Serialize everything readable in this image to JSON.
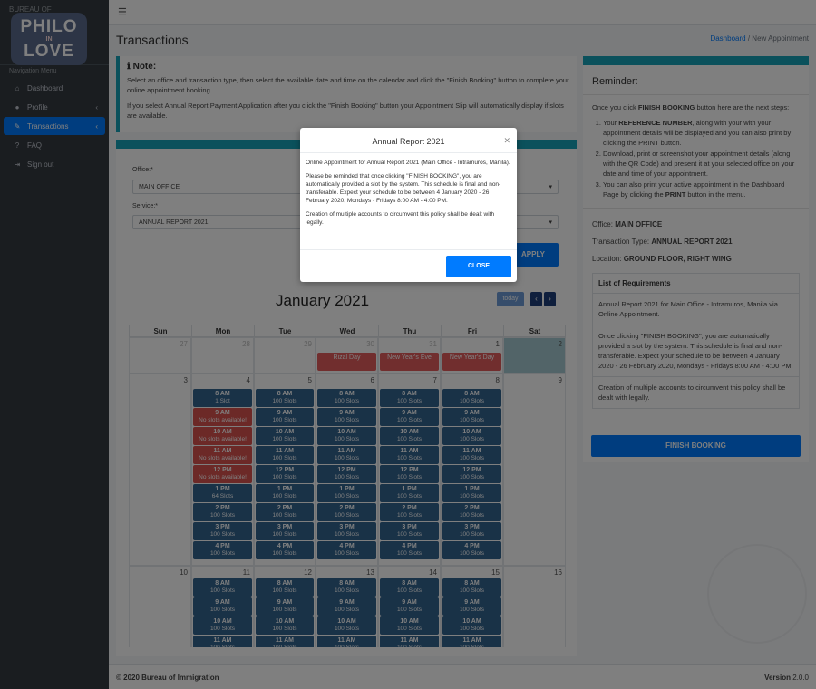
{
  "sidebar": {
    "brand_top": "BUREAU OF",
    "logo_line1": "PHILO",
    "logo_line2": "IN",
    "logo_line3": "LOVE",
    "nav_header": "Navigation Menu",
    "items": [
      {
        "label": "Dashboard",
        "icon": "home-icon",
        "glyph": "⌂"
      },
      {
        "label": "Profile",
        "icon": "user-icon",
        "glyph": "●"
      },
      {
        "label": "Transactions",
        "icon": "edit-icon",
        "glyph": "✎"
      },
      {
        "label": "FAQ",
        "icon": "question-icon",
        "glyph": "?"
      },
      {
        "label": "Sign out",
        "icon": "sign-out-icon",
        "glyph": "⇥"
      }
    ]
  },
  "topbar": {
    "menu_icon": "☰"
  },
  "page": {
    "title": "Transactions",
    "breadcrumb_home": "Dashboard",
    "breadcrumb_sep": "/",
    "breadcrumb_current": "New Appointment"
  },
  "note": {
    "title": "Note:",
    "icon": "ℹ",
    "p1": "Select an office and transaction type, then select the available date and time on the calendar and click the \"Finish Booking\" button to complete your online appointment booking.",
    "p2": "If you select Annual Report Payment Application after you click the \"Finish Booking\" button your Appointment Slip will automatically display if slots are available."
  },
  "form": {
    "office_label": "Office:*",
    "office_value": "MAIN OFFICE",
    "service_label": "Service:*",
    "service_value": "ANNUAL REPORT 2021",
    "apply_label": "APPLY"
  },
  "calendar": {
    "month_title": "January 2021",
    "today_label": "today",
    "prev_icon": "‹",
    "next_icon": "›",
    "weekdays": [
      "Sun",
      "Mon",
      "Tue",
      "Wed",
      "Thu",
      "Fri",
      "Sat"
    ],
    "week1_days": [
      "27",
      "28",
      "29",
      "30",
      "31",
      "1",
      "2"
    ],
    "week2_days": [
      "3",
      "4",
      "5",
      "6",
      "7",
      "8",
      "9"
    ],
    "week3_days": [
      "10",
      "11",
      "12",
      "13",
      "14",
      "15",
      "16"
    ],
    "holidays": [
      "Rizal Day",
      "New Year's Eve",
      "New Year's Day"
    ],
    "times": [
      "8 AM",
      "9 AM",
      "10 AM",
      "11 AM",
      "12 PM",
      "1 PM",
      "2 PM",
      "3 PM",
      "4 PM"
    ],
    "slots_text": "100 Slots",
    "mon_slots": [
      "1 Slot",
      "No slots available!",
      "No slots available!",
      "No slots available!",
      "No slots available!",
      "64 Slots",
      "100 Slots",
      "100 Slots",
      "100 Slots"
    ],
    "week3_times": [
      "8 AM",
      "9 AM",
      "10 AM",
      "11 AM"
    ]
  },
  "reminder": {
    "title": "Reminder:",
    "intro_pre": "Once you click ",
    "intro_bold": "FINISH BOOKING",
    "intro_post": " button here are the next steps:",
    "step1_pre": "Your ",
    "step1_bold": "REFERENCE NUMBER",
    "step1_post": ", along with your with your appointment details will be displayed and you can also print by clicking the PRINT button.",
    "step2": "Download, print or screenshot your appointment details (along with the QR Code) and present it at your selected office on your date and time of your appointment.",
    "step3_pre": "You can also print your active appointment in the Dashboard Page by clicking the ",
    "step3_bold": "PRINT",
    "step3_post": " button in the menu.",
    "office_label": "Office: ",
    "office_value": "MAIN OFFICE",
    "type_label": "Transaction Type: ",
    "type_value": "ANNUAL REPORT 2021",
    "location_label": "Location: ",
    "location_value": "GROUND FLOOR, RIGHT WING",
    "req_title": "List of Requirements",
    "req1": "Annual Report 2021 for Main Office - Intramuros, Manila via Online Appointment.",
    "req2": "Once clicking \"FINISH BOOKING\", you are automatically provided a slot by the system. This schedule is final and non-transferable. Expect your schedule to be between 4 January 2020 - 26 February 2020, Mondays - Fridays 8:00 AM - 4:00 PM.",
    "req3": "Creation of multiple accounts to circumvent this policy shall be dealt with legally.",
    "finish_label": "FINISH BOOKING"
  },
  "footer": {
    "copyright": "© 2020 Bureau of Immigration",
    "version_label": "Version",
    "version_value": "2.0.0"
  },
  "modal": {
    "title": "Annual Report 2021",
    "close_icon": "✕",
    "p1": "Online Appointment for Annual Report 2021 (Main Office - Intramuros, Manila).",
    "p2": "Please be reminded that once clicking \"FINISH BOOKING\", you are automatically provided a slot by the system. This schedule is final and non-transferable. Expect your schedule to be between 4 January 2020 - 26 February 2020, Mondays - Fridays 8:00 AM - 4:00 PM.",
    "p3": "Creation of multiple accounts to circumvent this policy shall be dealt with legally.",
    "button_label": "CLOSE"
  }
}
